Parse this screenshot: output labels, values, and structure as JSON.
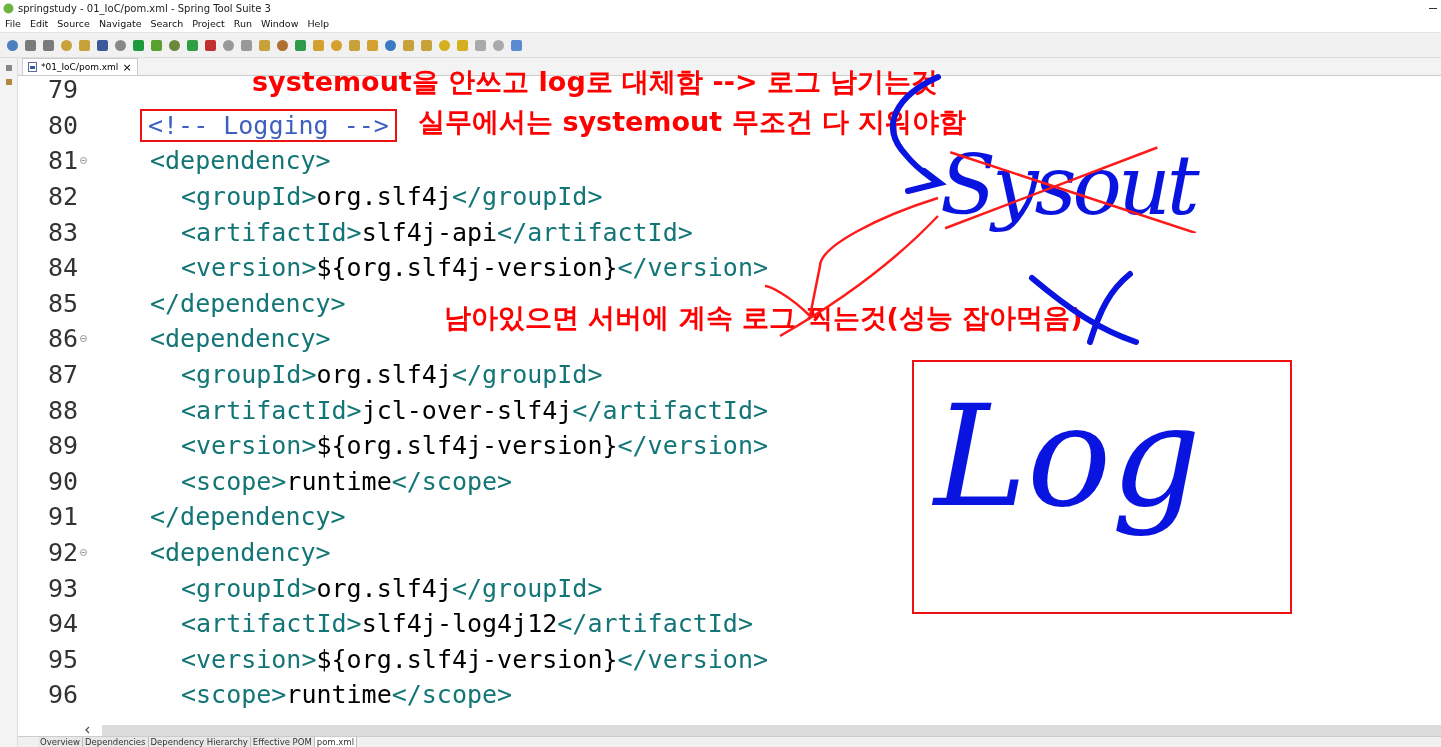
{
  "window": {
    "title": "springstudy - 01_IoC/pom.xml - Spring Tool Suite 3"
  },
  "menu": [
    "File",
    "Edit",
    "Source",
    "Navigate",
    "Search",
    "Project",
    "Run",
    "Window",
    "Help"
  ],
  "editor_tab": {
    "label": "*01_IoC/pom.xml",
    "close": "×"
  },
  "lines": [
    {
      "number": "79",
      "foldable": false
    },
    {
      "number": "80",
      "foldable": false,
      "indented": false,
      "parts": [
        {
          "kind": "comment",
          "text": "<!-- Logging -->"
        }
      ]
    },
    {
      "number": "81",
      "foldable": true,
      "indented": false,
      "parts": [
        {
          "kind": "tag",
          "text": "<dependency>"
        }
      ]
    },
    {
      "number": "82",
      "foldable": false,
      "indented": true,
      "parts": [
        {
          "kind": "tag",
          "text": "<groupId>"
        },
        {
          "kind": "text",
          "text": "org.slf4j"
        },
        {
          "kind": "tag",
          "text": "</groupId>"
        }
      ]
    },
    {
      "number": "83",
      "foldable": false,
      "indented": true,
      "parts": [
        {
          "kind": "tag",
          "text": "<artifactId>"
        },
        {
          "kind": "text",
          "text": "slf4j-api"
        },
        {
          "kind": "tag",
          "text": "</artifactId>"
        }
      ]
    },
    {
      "number": "84",
      "foldable": false,
      "indented": true,
      "parts": [
        {
          "kind": "tag",
          "text": "<version>"
        },
        {
          "kind": "text",
          "text": "${org.slf4j-version}"
        },
        {
          "kind": "tag",
          "text": "</version>"
        }
      ]
    },
    {
      "number": "85",
      "foldable": false,
      "indented": false,
      "parts": [
        {
          "kind": "tag",
          "text": "</dependency>"
        }
      ]
    },
    {
      "number": "86",
      "foldable": true,
      "indented": false,
      "parts": [
        {
          "kind": "tag",
          "text": "<dependency>"
        }
      ]
    },
    {
      "number": "87",
      "foldable": false,
      "indented": true,
      "parts": [
        {
          "kind": "tag",
          "text": "<groupId>"
        },
        {
          "kind": "text",
          "text": "org.slf4j"
        },
        {
          "kind": "tag",
          "text": "</groupId>"
        }
      ]
    },
    {
      "number": "88",
      "foldable": false,
      "indented": true,
      "parts": [
        {
          "kind": "tag",
          "text": "<artifactId>"
        },
        {
          "kind": "text",
          "text": "jcl-over-slf4j"
        },
        {
          "kind": "tag",
          "text": "</artifactId>"
        }
      ]
    },
    {
      "number": "89",
      "foldable": false,
      "indented": true,
      "parts": [
        {
          "kind": "tag",
          "text": "<version>"
        },
        {
          "kind": "text",
          "text": "${org.slf4j-version}"
        },
        {
          "kind": "tag",
          "text": "</version>"
        }
      ]
    },
    {
      "number": "90",
      "foldable": false,
      "indented": true,
      "parts": [
        {
          "kind": "tag",
          "text": "<scope>"
        },
        {
          "kind": "text",
          "text": "runtime"
        },
        {
          "kind": "tag",
          "text": "</scope>"
        }
      ]
    },
    {
      "number": "91",
      "foldable": false,
      "indented": false,
      "parts": [
        {
          "kind": "tag",
          "text": "</dependency>"
        }
      ]
    },
    {
      "number": "92",
      "foldable": true,
      "indented": false,
      "parts": [
        {
          "kind": "tag",
          "text": "<dependency>"
        }
      ]
    },
    {
      "number": "93",
      "foldable": false,
      "indented": true,
      "parts": [
        {
          "kind": "tag",
          "text": "<groupId>"
        },
        {
          "kind": "text",
          "text": "org.slf4j"
        },
        {
          "kind": "tag",
          "text": "</groupId>"
        }
      ]
    },
    {
      "number": "94",
      "foldable": false,
      "indented": true,
      "parts": [
        {
          "kind": "tag",
          "text": "<artifactId>"
        },
        {
          "kind": "text",
          "text": "slf4j-log4j12"
        },
        {
          "kind": "tag",
          "text": "</artifactId>"
        }
      ]
    },
    {
      "number": "95",
      "foldable": false,
      "indented": true,
      "parts": [
        {
          "kind": "tag",
          "text": "<version>"
        },
        {
          "kind": "text",
          "text": "${org.slf4j-version}"
        },
        {
          "kind": "tag",
          "text": "</version>"
        }
      ]
    },
    {
      "number": "96",
      "foldable": false,
      "indented": true,
      "parts": [
        {
          "kind": "tag",
          "text": "<scope>"
        },
        {
          "kind": "text",
          "text": "runtime"
        },
        {
          "kind": "tag",
          "text": "</scope>"
        }
      ]
    }
  ],
  "annotations": [
    {
      "text": "systemout을 안쓰고  log로 대체함 --> 로그 남기는것"
    },
    {
      "text": "실무에서는 systemout 무조건 다 지워야함"
    },
    {
      "text": "남아있으면 서버에 계속 로그 찍는것(성능 잡아먹음)"
    }
  ],
  "handwriting": [
    {
      "text": "Sysout"
    },
    {
      "text": "Log"
    }
  ],
  "bottom_tabs": [
    {
      "label": "Overview",
      "selected": false
    },
    {
      "label": "Dependencies",
      "selected": false
    },
    {
      "label": "Dependency Hierarchy",
      "selected": false
    },
    {
      "label": "Effective POM",
      "selected": false
    },
    {
      "label": "pom.xml",
      "selected": true
    }
  ]
}
